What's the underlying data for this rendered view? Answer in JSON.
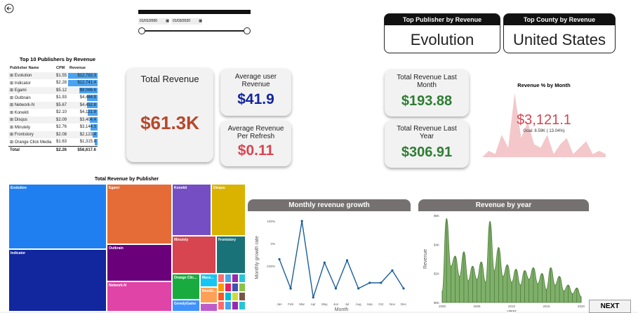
{
  "back_icon": "back-arrow-icon",
  "date_slicer": {
    "start": "01/01/2000",
    "end": "01/03/2020",
    "icon": "calendar-icon"
  },
  "kpis": {
    "top_publisher": {
      "title": "Top Publisher by Revenue",
      "value": "Evolution"
    },
    "top_county": {
      "title": "Top County by Revenue",
      "value": "United States"
    }
  },
  "publishers_table": {
    "title": "Top 10 Publishers by Revenue",
    "headers": [
      "Publisher Name",
      "CPM",
      "Revenue"
    ],
    "rows": [
      {
        "name": "Evolution",
        "cpm": "$1.55",
        "revenue": "$12,782.3",
        "rev_value": 12782.3
      },
      {
        "name": "Indicator",
        "cpm": "$2.28",
        "revenue": "$12,741.4",
        "rev_value": 12741.4
      },
      {
        "name": "Egami",
        "cpm": "$5.12",
        "revenue": "$8,066.6",
        "rev_value": 8066.6
      },
      {
        "name": "Outbrain",
        "cpm": "$1.93",
        "revenue": "$4,464.8",
        "rev_value": 4464.8
      },
      {
        "name": "Network-N",
        "cpm": "$5.67",
        "revenue": "$4,452.8",
        "rev_value": 4452.8
      },
      {
        "name": "Konekti",
        "cpm": "$2.10",
        "revenue": "$4,121.9",
        "rev_value": 4121.9
      },
      {
        "name": "Disqus",
        "cpm": "$2.09",
        "revenue": "$3,404.4",
        "rev_value": 3404.4
      },
      {
        "name": "Minutely",
        "cpm": "$2.76",
        "revenue": "$3,144.3",
        "rev_value": 3144.3
      },
      {
        "name": "Frontstory",
        "cpm": "$2.08",
        "revenue": "$2,123.4",
        "rev_value": 2123.4
      },
      {
        "name": "Orange Click Media",
        "cpm": "$1.63",
        "revenue": "$1,315.8",
        "rev_value": 1315.8
      }
    ],
    "total": {
      "label": "Total",
      "cpm": "$2.26",
      "revenue": "$56,617.6"
    }
  },
  "cards": {
    "total_revenue": {
      "title": "Total Revenue",
      "value": "$61.3K"
    },
    "avg_user_revenue": {
      "title": "Average user Revenue",
      "value": "$41.9"
    },
    "avg_revenue_refresh": {
      "title": "Average Revenue Per Refresh",
      "value": "$0.11"
    },
    "last_month": {
      "title": "Total Revenue Last Month",
      "value": "$193.88"
    },
    "last_year": {
      "title": "Total Revenue Last Year",
      "value": "$306.91"
    }
  },
  "gauge": {
    "title": "Revenue % by Month",
    "value": "$3,121.1",
    "goal": "Goal: 8.59K ( 13.04%)",
    "area_values": [
      0,
      0.1,
      0.05,
      0.35,
      0.15,
      1.0,
      0.3,
      0.55,
      0.2,
      0.15,
      0.35,
      0.05,
      0.2,
      0.3,
      0.05,
      0.15,
      0.25,
      0.05,
      0.1,
      0.05
    ]
  },
  "treemap": {
    "title": "Total Revenue by Publisher",
    "items": [
      {
        "label": "Evolution",
        "color": "#1f7ff0"
      },
      {
        "label": "Indicator",
        "color": "#12279d"
      },
      {
        "label": "Egami",
        "color": "#e66c37"
      },
      {
        "label": "Outbrain",
        "color": "#6b007b"
      },
      {
        "label": "Network-N",
        "color": "#e044a7"
      },
      {
        "label": "Konekti",
        "color": "#744ec2"
      },
      {
        "label": "Disqus",
        "color": "#d9b300"
      },
      {
        "label": "Minutely",
        "color": "#d64550"
      },
      {
        "label": "Frontstory",
        "color": "#197278"
      },
      {
        "label": "Orange Clic...",
        "color": "#1aab40"
      },
      {
        "label": "Mass...",
        "color": "#15c6f4"
      },
      {
        "label": "GreedyGame",
        "color": "#4092ff"
      },
      {
        "label": "NeedD...",
        "color": "#ffa058"
      },
      {
        "label": "",
        "color": "#be5dc9"
      }
    ]
  },
  "chart_data": [
    {
      "type": "line",
      "title": "Monthly revenue growth",
      "xlabel": "Month",
      "ylabel": "Monthly growth rate",
      "categories": [
        "Jan",
        "Feb",
        "Mar",
        "Apr",
        "May",
        "Jun",
        "Jul",
        "Aug",
        "Sep",
        "Oct",
        "Nov",
        "Dec"
      ],
      "values": [
        -70,
        -200,
        100,
        -240,
        -85,
        -200,
        -75,
        -200,
        -175,
        -175,
        -120,
        -200
      ],
      "yticks": [
        "100%",
        "0%",
        "-100%"
      ],
      "ylim": [
        -250,
        125
      ],
      "color": "#1b5e9a"
    },
    {
      "type": "area",
      "title": "Revenue by year",
      "xlabel": "year",
      "ylabel": "Revenue",
      "xticks": [
        "2000",
        "2005",
        "2010",
        "2015",
        "2020"
      ],
      "yticks": [
        "$0K",
        "$2K",
        "$4K",
        "$6K"
      ],
      "ylim": [
        0,
        6
      ],
      "color": "#7fb06a",
      "values": [
        0.8,
        5.8,
        2.5,
        3.2,
        1.8,
        3.5,
        1.5,
        2.5,
        1.6,
        2.8,
        1.4,
        5.6,
        2.2,
        3.8,
        1.8,
        2.6,
        1.4,
        2.3,
        1.2,
        2.2,
        1.6,
        2.4,
        1.3,
        2.0,
        0.9,
        2.4,
        1.2,
        1.8,
        0.8,
        1.2,
        0.6,
        1.0,
        0.4
      ]
    }
  ],
  "next_button": "NEXT"
}
